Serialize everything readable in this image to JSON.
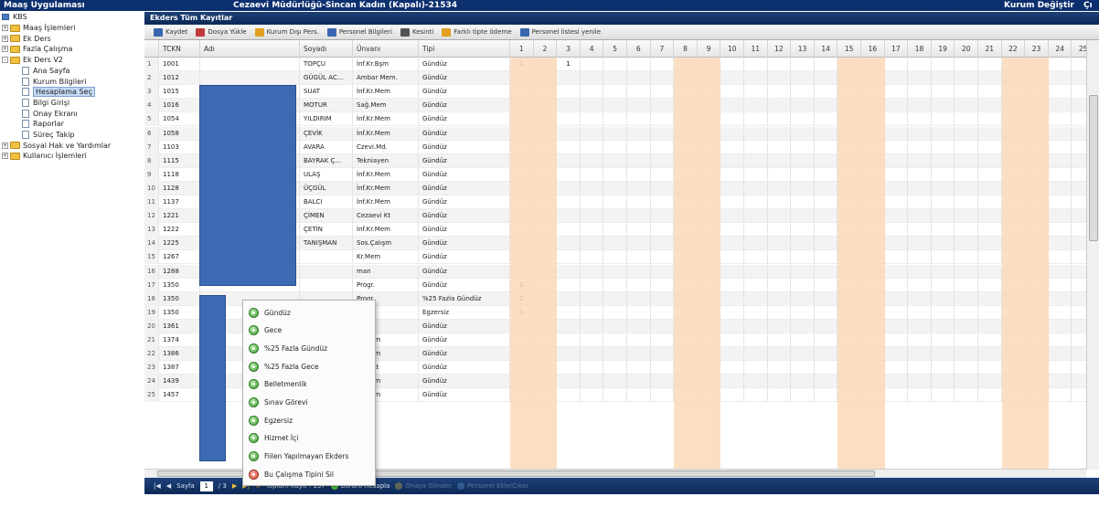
{
  "topbar": {
    "app_title": "Maaş Uygulaması",
    "center_title": "Cezaevi Müdürlüğü-Sincan Kadın (Kapalı)-21534",
    "right_link": "Kurum Değiştir",
    "far_right": "Çı"
  },
  "sidebar": {
    "root": "KBS",
    "items": [
      {
        "label": "Maaş İşlemleri",
        "type": "folder"
      },
      {
        "label": "Ek Ders",
        "type": "folder"
      },
      {
        "label": "Fazla Çalışma",
        "type": "folder"
      },
      {
        "label": "Ek Ders V2",
        "type": "folder-open"
      },
      {
        "label": "Ana Sayfa",
        "type": "page"
      },
      {
        "label": "Kurum Bilgileri",
        "type": "page"
      },
      {
        "label": "Hesaplama Seç",
        "type": "page",
        "selected": true
      },
      {
        "label": "Bilgi Girişi",
        "type": "page"
      },
      {
        "label": "Onay Ekranı",
        "type": "page"
      },
      {
        "label": "Raporlar",
        "type": "page"
      },
      {
        "label": "Süreç Takip",
        "type": "page"
      },
      {
        "label": "Sosyal Hak ve Yardımlar",
        "type": "folder"
      },
      {
        "label": "Kullanıcı İşlemleri",
        "type": "folder"
      }
    ]
  },
  "panel": {
    "title": "Ekders Tüm Kayıtlar"
  },
  "toolbar": [
    {
      "label": "Kaydet",
      "icon": "save-icon",
      "color": "#3a66b0"
    },
    {
      "label": "Dosya Yükle",
      "icon": "upload-icon",
      "color": "#c23b3b"
    },
    {
      "label": "Kurum Dışı Pers.",
      "icon": "people-icon",
      "color": "#e0a020"
    },
    {
      "label": "Personel Bilgileri",
      "icon": "card-icon",
      "color": "#3a66b0"
    },
    {
      "label": "Kesinti",
      "icon": "print-icon",
      "color": "#555555"
    },
    {
      "label": "Farklı tipte ödeme",
      "icon": "people-icon",
      "color": "#e0a020"
    },
    {
      "label": "Personel listesi yenile",
      "icon": "card-icon",
      "color": "#3a66b0"
    }
  ],
  "grid": {
    "columns": [
      "TCKN",
      "Adı",
      "Soyadı",
      "Ünvanı",
      "Tipi"
    ],
    "day_columns": [
      "1",
      "2",
      "3",
      "4",
      "5",
      "6",
      "7",
      "8",
      "9",
      "10",
      "11",
      "12",
      "13",
      "14",
      "15",
      "16",
      "17",
      "18",
      "19",
      "20",
      "21",
      "22",
      "23",
      "24",
      "25"
    ],
    "rows": [
      {
        "n": "1",
        "tckn": "1001",
        "adi": "",
        "soyadi": "TOPÇU",
        "unvan": "İnf.Kr.Bşm",
        "tipi": "Gündüz",
        "d1": "1",
        "d3": "1"
      },
      {
        "n": "2",
        "tckn": "1012",
        "adi": "",
        "soyadi": "GÜGÜL AC...",
        "unvan": "Ambar Mem.",
        "tipi": "Gündüz"
      },
      {
        "n": "3",
        "tckn": "1015",
        "adi": "",
        "soyadi": "SUAT",
        "unvan": "İnf.Kr.Mem",
        "tipi": "Gündüz"
      },
      {
        "n": "4",
        "tckn": "1016",
        "adi": "",
        "soyadi": "MOTUR",
        "unvan": "Sağ.Mem",
        "tipi": "Gündüz"
      },
      {
        "n": "5",
        "tckn": "1054",
        "adi": "",
        "soyadi": "YILDIRIM",
        "unvan": "İnf.Kr.Mem",
        "tipi": "Gündüz"
      },
      {
        "n": "6",
        "tckn": "1058",
        "adi": "",
        "soyadi": "ÇEVİK",
        "unvan": "İnf.Kr.Mem",
        "tipi": "Gündüz"
      },
      {
        "n": "7",
        "tckn": "1103",
        "adi": "",
        "soyadi": "AVARA",
        "unvan": "Czevi.Md.",
        "tipi": "Gündüz"
      },
      {
        "n": "8",
        "tckn": "1115",
        "adi": "",
        "soyadi": "BAYRAK Ç...",
        "unvan": "Tekniayen",
        "tipi": "Gündüz"
      },
      {
        "n": "9",
        "tckn": "1118",
        "adi": "",
        "soyadi": "ULAŞ",
        "unvan": "İnf.Kr.Mem",
        "tipi": "Gündüz"
      },
      {
        "n": "10",
        "tckn": "1128",
        "adi": "",
        "soyadi": "ÜÇGÜL",
        "unvan": "İnf.Kr.Mem",
        "tipi": "Gündüz"
      },
      {
        "n": "11",
        "tckn": "1137",
        "adi": "",
        "soyadi": "BALCI",
        "unvan": "İnf.Kr.Mem",
        "tipi": "Gündüz"
      },
      {
        "n": "12",
        "tckn": "1221",
        "adi": "",
        "soyadi": "ÇİMEN",
        "unvan": "Cezaevi Kt",
        "tipi": "Gündüz"
      },
      {
        "n": "13",
        "tckn": "1222",
        "adi": "",
        "soyadi": "ÇETİN",
        "unvan": "İnf.Kr.Mem",
        "tipi": "Gündüz"
      },
      {
        "n": "14",
        "tckn": "1225",
        "adi": "",
        "soyadi": "TANIŞMAN",
        "unvan": "Sos.Çalışm",
        "tipi": "Gündüz"
      },
      {
        "n": "15",
        "tckn": "1267",
        "adi": "",
        "soyadi": "",
        "unvan": "Kr.Mem",
        "tipi": "Gündüz"
      },
      {
        "n": "16",
        "tckn": "1288",
        "adi": "",
        "soyadi": "",
        "unvan": "man",
        "tipi": "Gündüz"
      },
      {
        "n": "17",
        "tckn": "1350",
        "adi": "",
        "soyadi": "",
        "unvan": "Progr.",
        "tipi": "Gündüz",
        "d1": "1"
      },
      {
        "n": "18",
        "tckn": "1350",
        "adi": "",
        "soyadi": "",
        "unvan": "Progr.",
        "tipi": "%25 Fazla Gündüz",
        "d1": "1"
      },
      {
        "n": "19",
        "tckn": "1350",
        "adi": "",
        "soyadi": "",
        "unvan": "Progr.",
        "tipi": "Egzersiz",
        "d1": "1"
      },
      {
        "n": "20",
        "tckn": "1361",
        "adi": "",
        "soyadi": "",
        "unvan": "Hiteg.",
        "tipi": "Gündüz"
      },
      {
        "n": "21",
        "tckn": "1374",
        "adi": "",
        "soyadi": "",
        "unvan": "Kr.Mem",
        "tipi": "Gündüz"
      },
      {
        "n": "22",
        "tckn": "1386",
        "adi": "",
        "soyadi": "",
        "unvan": "Kr.Mem",
        "tipi": "Gündüz"
      },
      {
        "n": "23",
        "tckn": "1387",
        "adi": "",
        "soyadi": "",
        "unvan": "aevi Kt",
        "tipi": "Gündüz"
      },
      {
        "n": "24",
        "tckn": "1439",
        "adi": "",
        "soyadi": "",
        "unvan": "Kr.Mem",
        "tipi": "Gündüz"
      },
      {
        "n": "25",
        "tckn": "1457",
        "adi": "",
        "soyadi": "",
        "unvan": "Kr.Mem",
        "tipi": "Gündüz"
      }
    ]
  },
  "context_menu": [
    {
      "label": "Gündüz",
      "icon": "green-circle-icon"
    },
    {
      "label": "Gece",
      "icon": "green-circle-icon"
    },
    {
      "label": "%25 Fazla Gündüz",
      "icon": "green-circle-icon"
    },
    {
      "label": "%25 Fazla Gece",
      "icon": "green-circle-icon"
    },
    {
      "label": "Belletmenlik",
      "icon": "green-circle-icon"
    },
    {
      "label": "Sınav Görevi",
      "icon": "green-circle-icon"
    },
    {
      "label": "Egzersiz",
      "icon": "green-circle-icon"
    },
    {
      "label": "Hizmet İçi",
      "icon": "green-circle-icon"
    },
    {
      "label": "Fiilen Yapılmayan Ekders",
      "icon": "green-circle-icon"
    },
    {
      "label": "Bu Çalışma Tipini Sil",
      "icon": "red-circle-icon"
    }
  ],
  "pager": {
    "page_label": "Sayfa",
    "page_value": "1",
    "of_label": "/ 3",
    "total_label": "Toplam Kayıt : 137",
    "bordro_label": "Bordro Hesapla",
    "extra1": "Onaya Gönder",
    "extra2": "Personel Ekle/Çıkar"
  },
  "colors": {
    "highlight_columns": "#fbd9b8",
    "header_blue": "#0c2f6e",
    "redaction": "#3d6bb3"
  }
}
